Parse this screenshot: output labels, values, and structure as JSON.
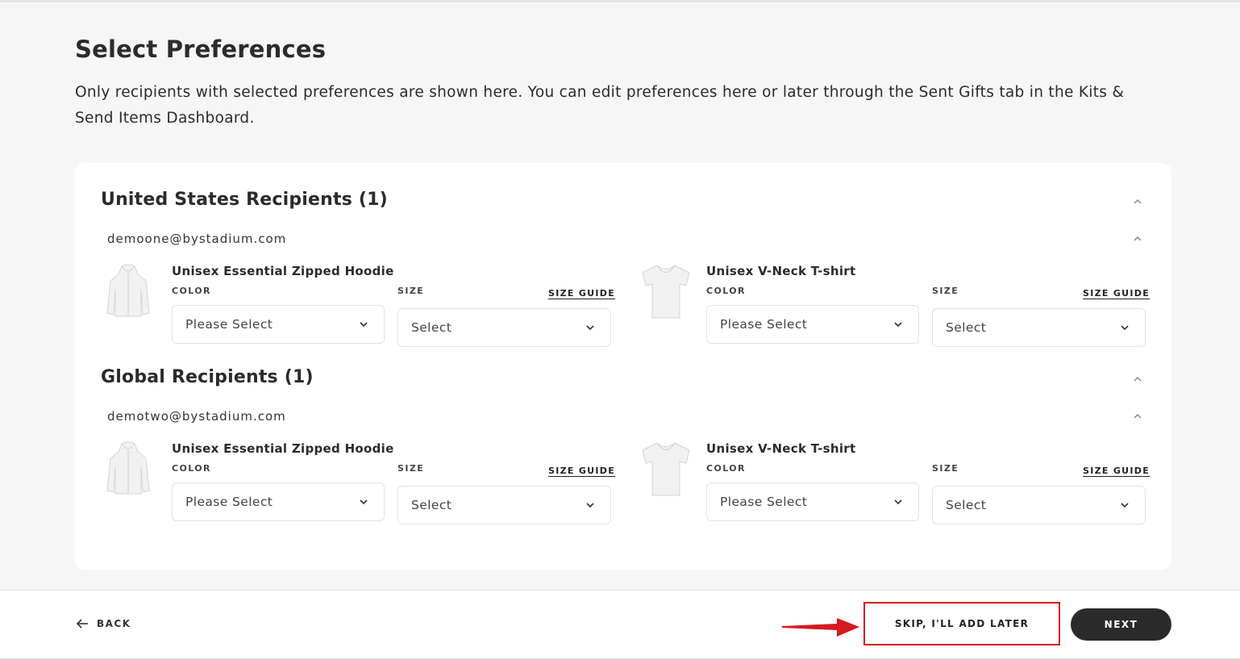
{
  "page": {
    "title": "Select Preferences",
    "description": "Only recipients with selected preferences are shown here. You can edit preferences here or later through the Sent Gifts tab in the Kits & Send Items Dashboard."
  },
  "sections": [
    {
      "title": "United States Recipients (1)",
      "recipient_email": "demoone@bystadium.com",
      "products": [
        {
          "name": "Unisex Essential Zipped Hoodie",
          "color_label": "COLOR",
          "color_value": "Please Select",
          "size_label": "SIZE",
          "size_value": "Select",
          "size_guide": "SIZE GUIDE",
          "icon": "hoodie-icon"
        },
        {
          "name": "Unisex V-Neck T-shirt",
          "color_label": "COLOR",
          "color_value": "Please Select",
          "size_label": "SIZE",
          "size_value": "Select",
          "size_guide": "SIZE GUIDE",
          "icon": "tshirt-icon"
        }
      ]
    },
    {
      "title": "Global Recipients (1)",
      "recipient_email": "demotwo@bystadium.com",
      "products": [
        {
          "name": "Unisex Essential Zipped Hoodie",
          "color_label": "COLOR",
          "color_value": "Please Select",
          "size_label": "SIZE",
          "size_value": "Select",
          "size_guide": "SIZE GUIDE",
          "icon": "hoodie-icon"
        },
        {
          "name": "Unisex V-Neck T-shirt",
          "color_label": "COLOR",
          "color_value": "Please Select",
          "size_label": "SIZE",
          "size_value": "Select",
          "size_guide": "SIZE GUIDE",
          "icon": "tshirt-icon"
        }
      ]
    }
  ],
  "footer": {
    "back_label": "BACK",
    "skip_label": "SKIP, I'LL ADD LATER",
    "next_label": "NEXT"
  },
  "colors": {
    "highlight": "#d71920",
    "primary_button": "#2b2b2b",
    "background": "#f6f6f6"
  }
}
